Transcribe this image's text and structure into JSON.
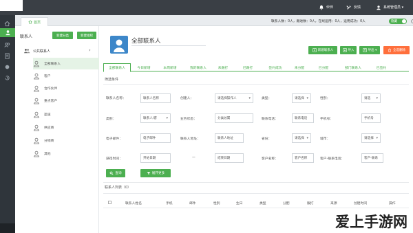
{
  "topbar": {
    "items": [
      {
        "label": "伙伴",
        "icon": "bell-icon"
      },
      {
        "label": "反馈",
        "icon": "tools-icon"
      },
      {
        "label": "系统管理员 ▾",
        "icon": "user-icon"
      }
    ]
  },
  "leftnav": {
    "icons": [
      "home-icon",
      "person-icon",
      "group-icon",
      "document-icon",
      "circle-icon",
      "history-icon"
    ],
    "active_index": 1
  },
  "tabbar": {
    "home_label": "首页",
    "stats": "联系人数：0人，跟进数：0人，在线运用：0人，运用成功：0人",
    "toggle_label": "隐藏"
  },
  "sidebar": {
    "title": "联系人",
    "btn_new_group": "新建分类",
    "btn_edit_group": "新建组织",
    "root_label": "公共联系人",
    "items": [
      {
        "label": "全部联系人"
      },
      {
        "label": "客户"
      },
      {
        "label": "合作伙伴"
      },
      {
        "label": "重点客户"
      },
      {
        "label": "渠道"
      },
      {
        "label": "供应商"
      },
      {
        "label": "分销商"
      },
      {
        "label": "其他"
      }
    ]
  },
  "main": {
    "title": "全部联系人",
    "actions": {
      "new_contact": "新建联系人",
      "import": "导入",
      "export": "导出 ▾",
      "delete": "全选删除"
    },
    "tabs": [
      "全部联系人",
      "今日新增",
      "本周新增",
      "我的联系人",
      "未跟打",
      "已跟打",
      "签约成功",
      "未分配",
      "已分配",
      "部门联系人",
      "已签约"
    ],
    "filter_section": "筛选条件",
    "filters": {
      "contact_name_label": "联系人名称：",
      "contact_name_ph": "联系人名称",
      "creator_label": "创建人：",
      "creator_ph": "请选择操作人",
      "type_label": "类型：",
      "type_value": "请选择",
      "gender_label": "性别：",
      "gender_value": "请选",
      "category_label": "类别：",
      "category_value": "联系人/客",
      "biz_status_label": "业务状态：",
      "biz_status_value": "分类总属",
      "contact_phone_label": "联系电话：",
      "contact_phone_ph": "联系电话",
      "mobile_label": "手机号：",
      "mobile_ph": "手机号",
      "email_label": "电子邮件：",
      "email_ph": "电子邮件",
      "address_label": "联系人地址：",
      "address_ph": "联系人地址",
      "province_label": "省份：",
      "province_value": "请选择",
      "city_label": "城市：",
      "city_value": "请选择",
      "time_label": "获得时间：",
      "start_ph": "开始日期",
      "range_sep": "—",
      "end_ph": "结束日期",
      "customer_name_label": "客户名称：",
      "customer_name_ph": "客户名称",
      "customer_contact_label": "客户-联系电话：",
      "customer_contact_ph": "客户-联系"
    },
    "search_btn": "查询",
    "filter_btn": "展开更多",
    "list_title": "联系人列表（0）",
    "columns": [
      "联系人姓名",
      "手机",
      "邮件",
      "性别",
      "生日",
      "类型",
      "分配",
      "跟打",
      "来源",
      "创建时间",
      "操作"
    ]
  },
  "watermark": "爱上手游网",
  "colors": {
    "accent": "#4caf50",
    "orange": "#ff6f3c",
    "nav": "#2f353b",
    "avatar": "#3d87c9"
  }
}
